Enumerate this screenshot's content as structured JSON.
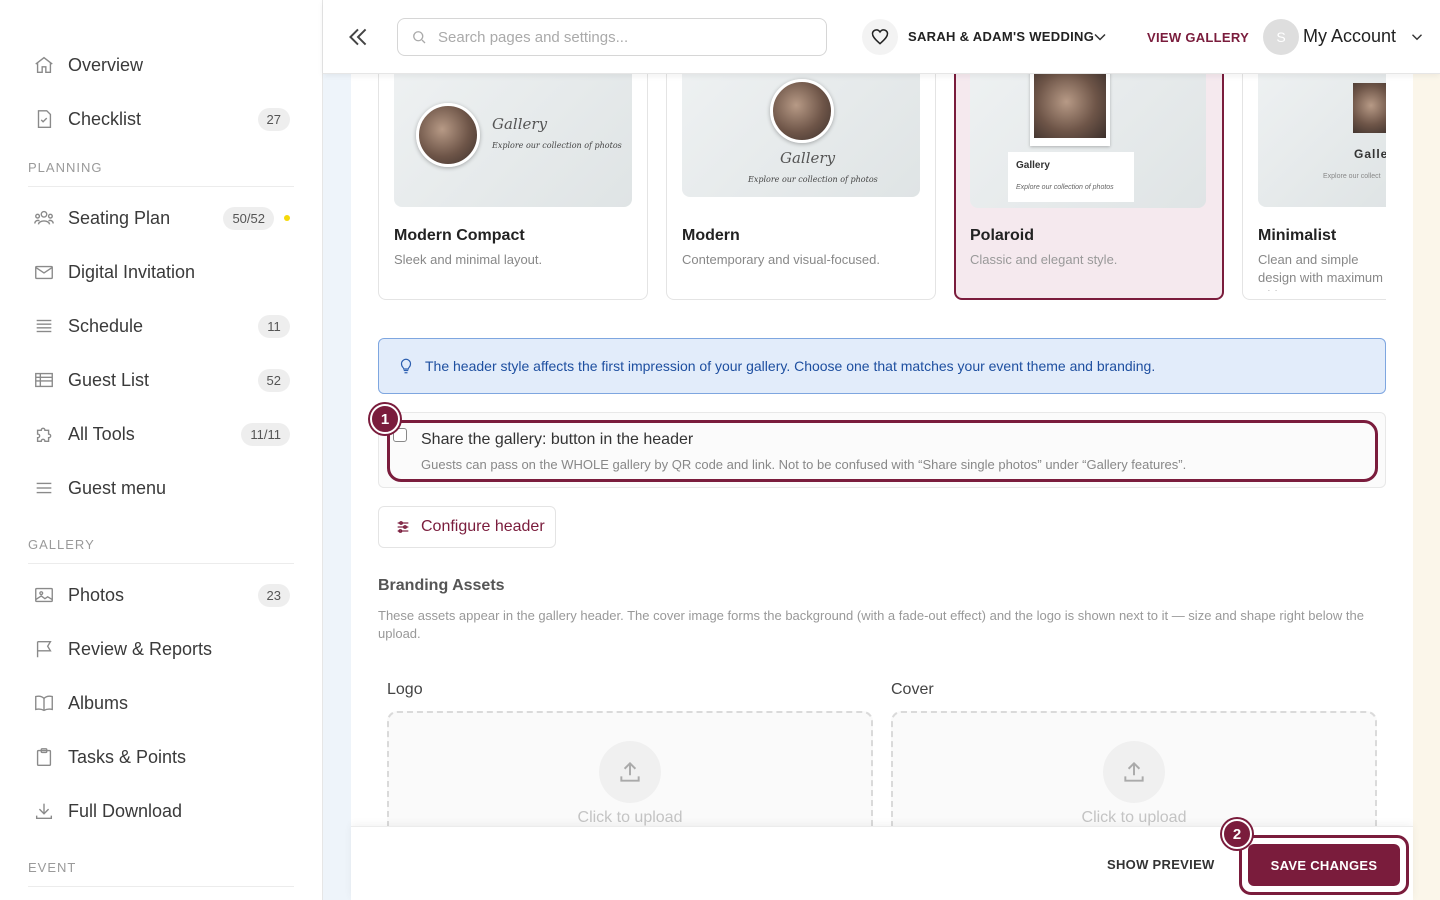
{
  "sidebar": {
    "items_top": [
      {
        "label": "Overview",
        "badge": ""
      },
      {
        "label": "Checklist",
        "badge": "27"
      }
    ],
    "planning_label": "PLANNING",
    "planning": [
      {
        "label": "Seating Plan",
        "badge": "50/52"
      },
      {
        "label": "Digital Invitation",
        "badge": ""
      },
      {
        "label": "Schedule",
        "badge": "11"
      },
      {
        "label": "Guest List",
        "badge": "52"
      },
      {
        "label": "All Tools",
        "badge": "11/11"
      },
      {
        "label": "Guest menu",
        "badge": ""
      }
    ],
    "gallery_label": "GALLERY",
    "gallery": [
      {
        "label": "Photos",
        "badge": "23"
      },
      {
        "label": "Review & Reports",
        "badge": ""
      },
      {
        "label": "Albums",
        "badge": ""
      },
      {
        "label": "Tasks & Points",
        "badge": ""
      },
      {
        "label": "Full Download",
        "badge": ""
      }
    ],
    "event_label": "EVENT",
    "seating_dot_color": "#f5d90a"
  },
  "topbar": {
    "search_placeholder": "Search pages and settings...",
    "event_name": "SARAH & ADAM'S WEDDING",
    "view_gallery": "VIEW GALLERY",
    "avatar_initial": "S",
    "account": "My Account"
  },
  "cards": [
    {
      "title": "Modern Compact",
      "desc": "Sleek and minimal layout.",
      "thumb_title": "Gallery",
      "thumb_sub": "Explore our collection of photos"
    },
    {
      "title": "Modern",
      "desc": "Contemporary and visual-focused.",
      "thumb_title": "Gallery",
      "thumb_sub": "Explore our collection of photos"
    },
    {
      "title": "Polaroid",
      "desc": "Classic and elegant style.",
      "thumb_title": "Gallery",
      "thumb_sub": "Explore our collection of photos",
      "selected": true
    },
    {
      "title": "Minimalist",
      "desc": "Clean and simple design with maximum whitespace",
      "thumb_title": "Galle",
      "thumb_sub": "Explore our collect"
    }
  ],
  "info": "The header style affects the first impression of your gallery. Choose one that matches your event theme and branding.",
  "share": {
    "title": "Share the gallery: button in the header",
    "desc": "Guests can pass on the WHOLE gallery by QR code and link. Not to be confused with “Share single photos” under “Gallery features”."
  },
  "steps": {
    "one": "1",
    "two": "2"
  },
  "configure_header": "Configure header",
  "branding": {
    "title": "Branding Assets",
    "desc": "These assets appear in the gallery header. The cover image forms the background (with a fade-out effect) and the logo is shown next to it — size and shape right below the upload.",
    "logo_label": "Logo",
    "cover_label": "Cover",
    "upload_text": "Click to upload"
  },
  "footer": {
    "show_preview": "SHOW PREVIEW",
    "save": "SAVE CHANGES"
  },
  "colors": {
    "accent": "#7a1c3c",
    "info_bg": "#e2ecfa",
    "info_text": "#1e4fa0"
  }
}
